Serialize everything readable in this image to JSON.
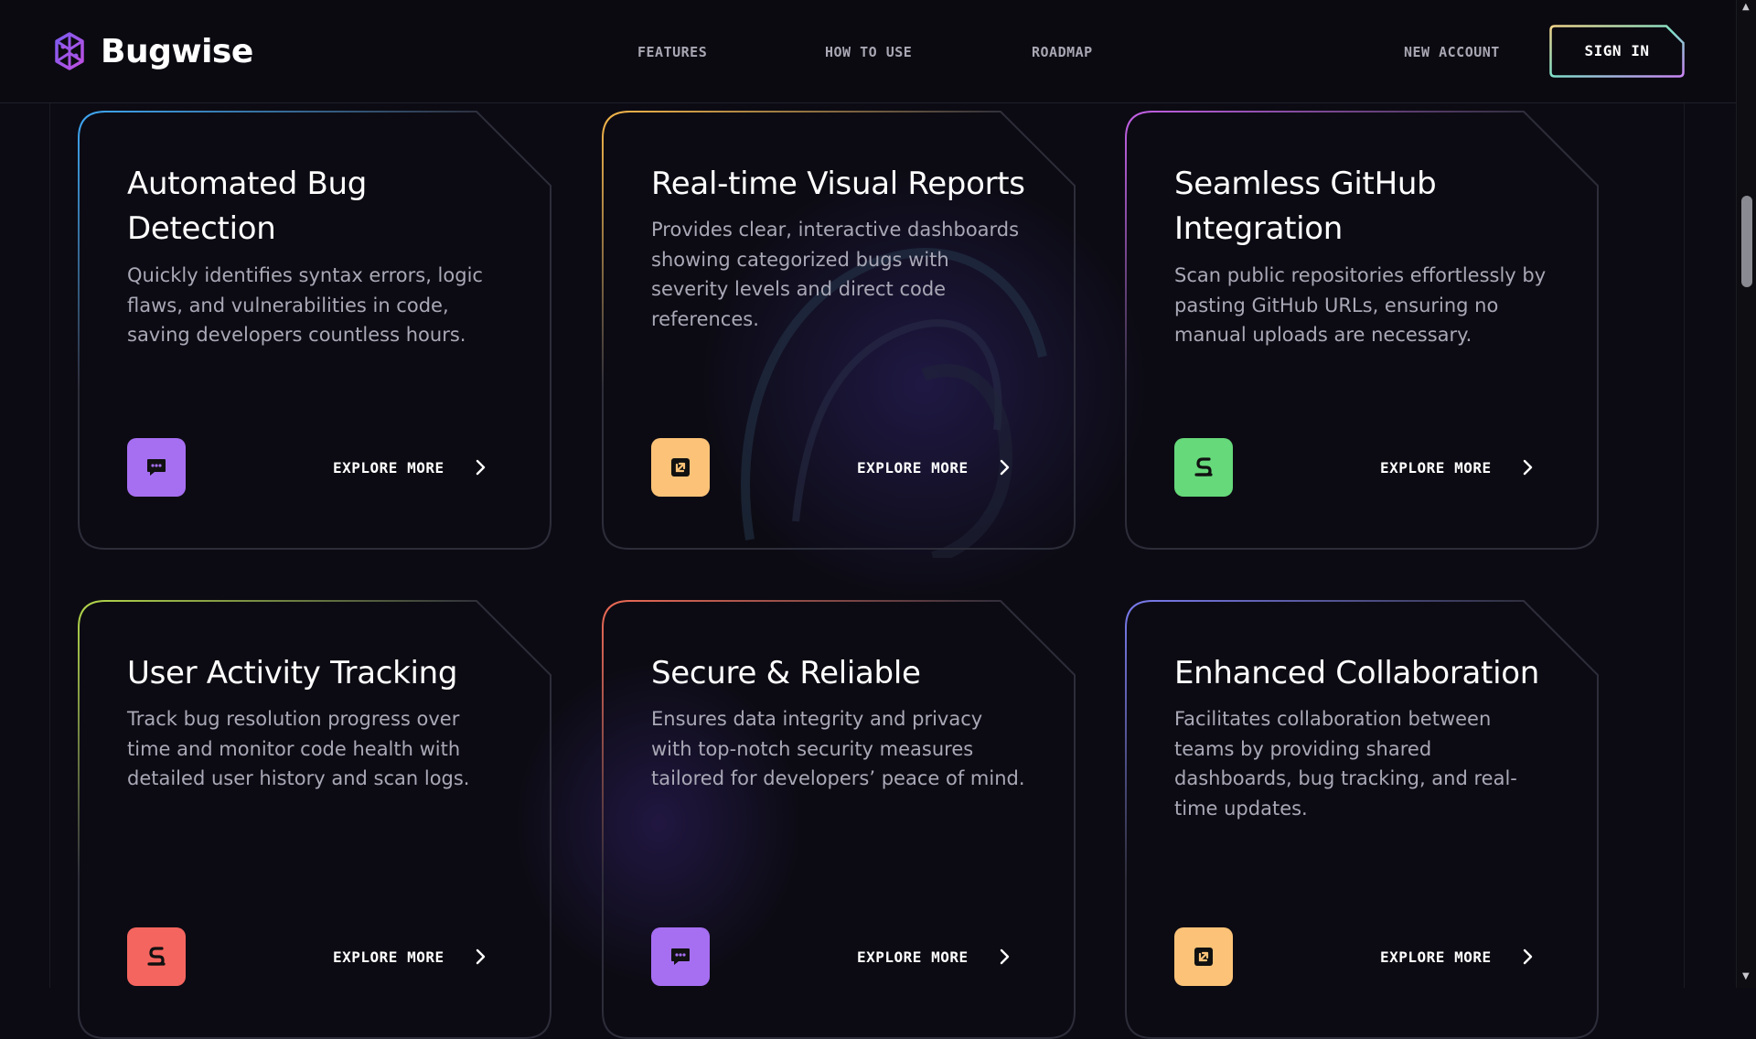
{
  "header": {
    "brand": "Bugwise",
    "nav": [
      "FEATURES",
      "HOW TO USE",
      "ROADMAP"
    ],
    "new_account": "NEW ACCOUNT",
    "sign_in": "SIGN IN"
  },
  "cards": [
    {
      "title": "Automated Bug Detection",
      "description": "Quickly identifies syntax errors, logic flaws, and vulnerabilities in code, saving developers countless hours.",
      "icon": "chat-bubble-icon",
      "icon_color": "#a66ff2",
      "border_colors": [
        "#3fa9f5",
        "#2d2d3a"
      ],
      "cta": "EXPLORE MORE"
    },
    {
      "title": "Real-time Visual Reports",
      "description": "Provides clear, interactive dashboards showing categorized bugs with severity levels and direct code references.",
      "icon": "external-link-icon",
      "icon_color": "#fcc378",
      "border_colors": [
        "#f7b84a",
        "#2d2d3a"
      ],
      "cta": "EXPLORE MORE"
    },
    {
      "title": "Seamless GitHub Integration",
      "description": "Scan public repositories effortlessly by pasting GitHub URLs, ensuring no manual uploads are necessary.",
      "icon": "plug-icon",
      "icon_color": "#66d97a",
      "border_colors": [
        "#c561e8",
        "#2d2d3a"
      ],
      "cta": "EXPLORE MORE"
    },
    {
      "title": "User Activity Tracking",
      "description": "Track bug resolution progress over time and monitor code health with detailed user history and scan logs.",
      "icon": "plug-icon",
      "icon_color": "#f5655f",
      "border_colors": [
        "#b5d94b",
        "#2d2d3a"
      ],
      "cta": "EXPLORE MORE"
    },
    {
      "title": "Secure & Reliable",
      "description": "Ensures data integrity and privacy with top-notch security measures tailored for developers’ peace of mind.",
      "icon": "chat-bubble-icon",
      "icon_color": "#a66ff2",
      "border_colors": [
        "#f06b56",
        "#2d2d3a"
      ],
      "cta": "EXPLORE MORE"
    },
    {
      "title": "Enhanced Collaboration",
      "description": "Facilitates collaboration between teams by providing shared dashboards, bug tracking, and real-time updates.",
      "icon": "external-link-icon",
      "icon_color": "#fcc378",
      "border_colors": [
        "#7b7cf0",
        "#2d2d3a"
      ],
      "cta": "EXPLORE MORE"
    }
  ]
}
